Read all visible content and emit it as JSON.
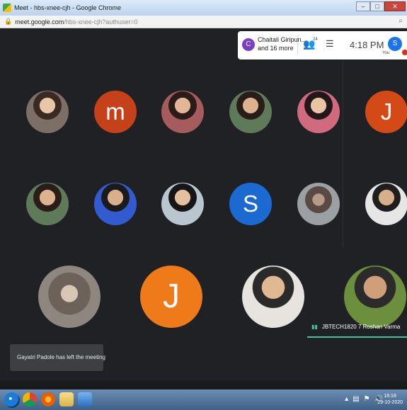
{
  "window": {
    "title": "Meet - hbs-xnee-cjh - Google Chrome",
    "controls": {
      "minimize": "–",
      "maximize": "□",
      "close": "✕"
    }
  },
  "browser": {
    "url_host": "meet.google.com",
    "url_path": "/hbs-xnee-cjh?authuser=0"
  },
  "meet": {
    "people_summary": {
      "avatar_letter": "C",
      "line1": "Chaitali Giripun...",
      "line2": "and 16 more"
    },
    "participants_count": "24",
    "clock": "4:18 PM",
    "self": {
      "avatar_letter": "S",
      "label": "You"
    },
    "tiles": [
      {
        "type": "photo",
        "variant": "p1"
      },
      {
        "type": "letter",
        "letter": "m",
        "color": "#c5411a"
      },
      {
        "type": "photo",
        "variant": "p2"
      },
      {
        "type": "photo",
        "variant": "p3"
      },
      {
        "type": "photo",
        "variant": "p4"
      },
      {
        "type": "letter",
        "letter": "J",
        "color": "#d44a17"
      },
      {
        "type": "photo",
        "variant": "p3"
      },
      {
        "type": "photo",
        "variant": "p5"
      },
      {
        "type": "photo",
        "variant": "p6"
      },
      {
        "type": "letter",
        "letter": "S",
        "color": "#1b6ad1"
      },
      {
        "type": "photo",
        "variant": "p7"
      },
      {
        "type": "photo",
        "variant": "p8"
      },
      {
        "type": "photo",
        "variant": "p9"
      },
      {
        "type": "letter",
        "letter": "J",
        "color": "#ef7a1a"
      },
      {
        "type": "photo",
        "variant": "p10"
      },
      {
        "type": "photo",
        "variant": "p11"
      }
    ],
    "active_speaker": "JBTECH1820 7 Roshan Varma",
    "toast": "Gayatri Padole has left the meeting"
  },
  "taskbar": {
    "time": "16:18",
    "date": "29-10-2020"
  },
  "colors": {
    "meet_background": "#202124",
    "accent_teal": "#44c1a0"
  }
}
